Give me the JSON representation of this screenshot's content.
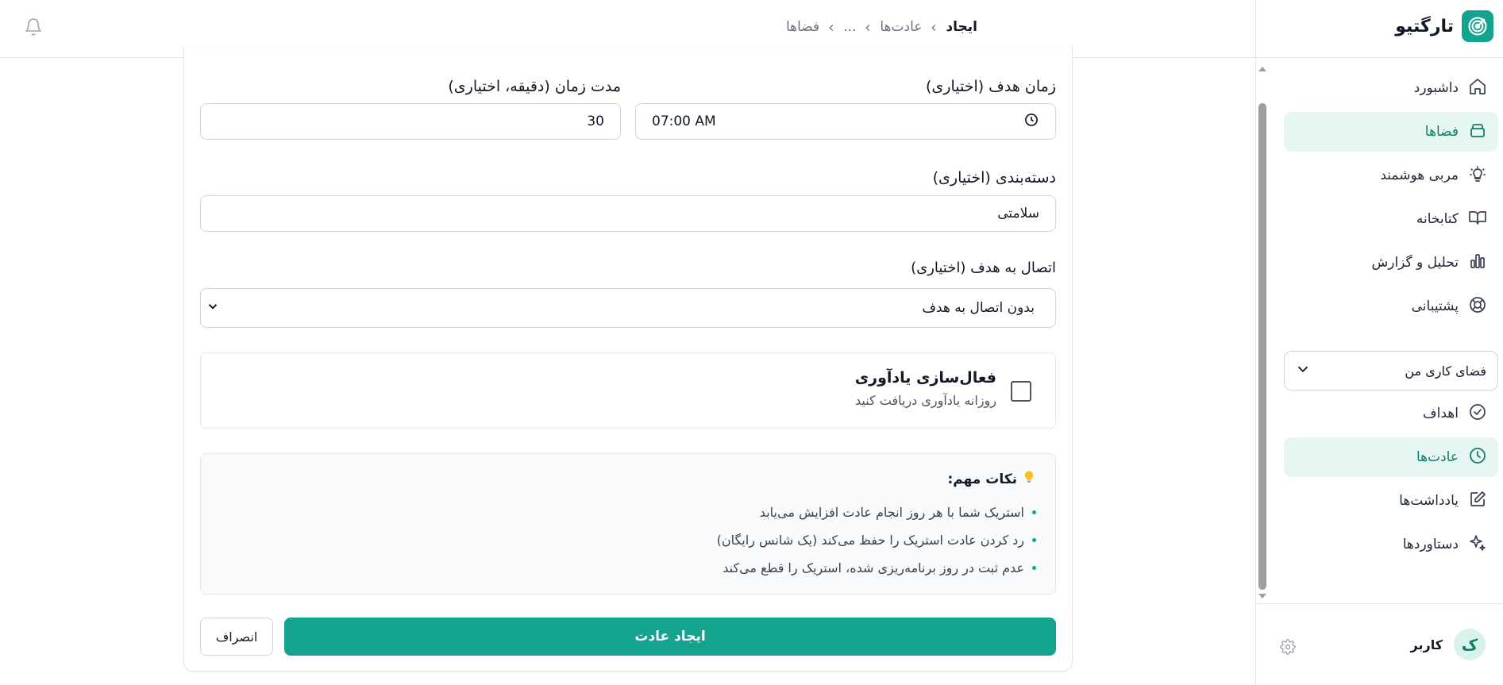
{
  "header": {
    "breadcrumb": [
      "فضاها",
      "...",
      "عادت‌ها",
      "ایجاد"
    ],
    "notification_icon": "bell-icon"
  },
  "sidebar": {
    "brand_name": "تارگتیو",
    "brand_icon": "target-icon",
    "accent_color": "#14a38f",
    "nav_top": [
      {
        "label": "داشبورد",
        "icon": "home-icon",
        "active": false
      },
      {
        "label": "فضاها",
        "icon": "layers-icon",
        "active": true
      },
      {
        "label": "مربی هوشمند",
        "icon": "lightbulb-icon",
        "active": false
      },
      {
        "label": "کتابخانه",
        "icon": "book-icon",
        "active": false
      },
      {
        "label": "تحلیل و گزارش",
        "icon": "chart-icon",
        "active": false
      },
      {
        "label": "پشتیبانی",
        "icon": "lifebuoy-icon",
        "active": false
      }
    ],
    "workspace_select": "فضای کاری من",
    "nav_workspace": [
      {
        "label": "اهداف",
        "icon": "check-circle-icon",
        "active": false
      },
      {
        "label": "عادت‌ها",
        "icon": "clock-icon",
        "active": true
      },
      {
        "label": "یادداشت‌ها",
        "icon": "edit-icon",
        "active": false
      },
      {
        "label": "دستاوردها",
        "icon": "sparkles-icon",
        "active": false
      }
    ],
    "user": {
      "avatar_letter": "ک",
      "name": "کاربر"
    }
  },
  "form": {
    "target_time": {
      "label": "زمان هدف (اختیاری)",
      "value": "07:00  AM"
    },
    "duration": {
      "label": "مدت زمان (دقیقه، اختیاری)",
      "value": "30"
    },
    "category": {
      "label": "دسته‌بندی (اختیاری)",
      "value": "سلامتی"
    },
    "goal_link": {
      "label": "اتصال به هدف (اختیاری)",
      "selected": "بدون اتصال به هدف"
    },
    "reminder": {
      "title": "فعال‌سازی یادآوری",
      "subtitle": "روزانه یادآوری دریافت کنید",
      "checked": false
    },
    "tips": {
      "title": "نکات مهم:",
      "items": [
        "استریک شما با هر روز انجام عادت افزایش می‌یابد",
        "رد کردن عادت استریک را حفظ می‌کند (یک شانس رایگان)",
        "عدم ثبت در روز برنامه‌ریزی شده، استریک را قطع می‌کند"
      ]
    },
    "submit_label": "ایجاد عادت",
    "cancel_label": "انصراف"
  }
}
